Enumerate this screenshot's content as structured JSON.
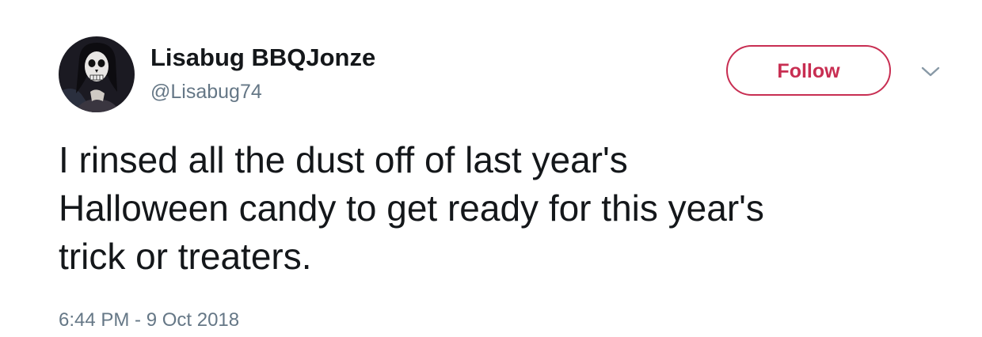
{
  "tweet": {
    "author": {
      "display_name": "Lisabug BBQJonze",
      "handle": "@Lisabug74",
      "avatar": "skull-makeup-avatar"
    },
    "follow_label": "Follow",
    "menu_icon": "chevron-down-icon",
    "text_lines": [
      "I rinsed all the dust off of last year's",
      "Halloween candy to get ready for this year's",
      "trick or treaters."
    ],
    "timestamp": "6:44 PM - 9 Oct 2018"
  },
  "colors": {
    "accent": "#c82e52",
    "text": "#14171a",
    "secondary_text": "#657786"
  }
}
